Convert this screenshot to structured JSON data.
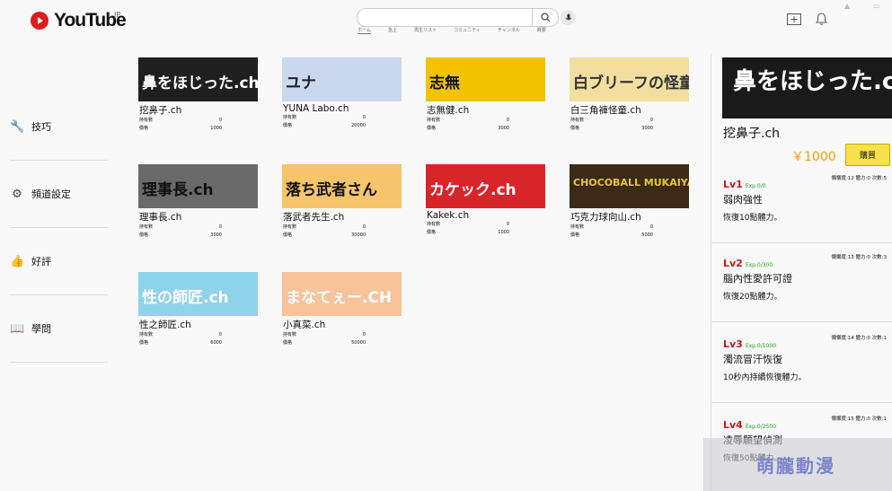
{
  "header": {
    "brand": "YouTube",
    "region": "JP",
    "tabs": [
      "ホーム",
      "急上",
      "再生リスト",
      "コミュニティ",
      "チャンネル",
      "概要"
    ]
  },
  "sidebar": {
    "items": [
      {
        "label": "技巧",
        "icon": "wrench-icon"
      },
      {
        "label": "頻道設定",
        "icon": "gear-icon"
      },
      {
        "label": "好評",
        "icon": "thumbs-up-icon"
      },
      {
        "label": "學問",
        "icon": "book-icon"
      }
    ]
  },
  "stat_labels": {
    "owned": "持有數",
    "price": "價格"
  },
  "channels": [
    {
      "name": "挖鼻子.ch",
      "thumb_text": "鼻をほじった.ch",
      "owned": "0",
      "price": "1000",
      "bg": "#1f1f1f",
      "fg": "#ffffff"
    },
    {
      "name": "YUNA Labo.ch",
      "thumb_text": "ユナ",
      "owned": "0",
      "price": "20000",
      "bg": "#c9d8ef",
      "fg": "#222222"
    },
    {
      "name": "志無健.ch",
      "thumb_text": "志無",
      "owned": "0",
      "price": "3000",
      "bg": "#f3c300",
      "fg": "#111111"
    },
    {
      "name": "白三角褲怪童.ch",
      "thumb_text": "白ブリーフの怪童",
      "owned": "0",
      "price": "3000",
      "bg": "#f2dfa0",
      "fg": "#333333"
    },
    {
      "name": "理事長.ch",
      "thumb_text": "理事長.ch",
      "owned": "0",
      "price": "3000",
      "bg": "#6a6a6a",
      "fg": "#111111"
    },
    {
      "name": "落武者先生.ch",
      "thumb_text": "落ち武者さん",
      "owned": "0",
      "price": "30000",
      "bg": "#f5c46b",
      "fg": "#111111"
    },
    {
      "name": "Kakek.ch",
      "thumb_text": "カケック.ch",
      "owned": "0",
      "price": "1000",
      "bg": "#d8252a",
      "fg": "#ffffff"
    },
    {
      "name": "巧克力球向山.ch",
      "thumb_text": "CHOCOBALL MUKAIYAMA",
      "owned": "0",
      "price": "5000",
      "bg": "#3b2b16",
      "fg": "#e8c43a"
    },
    {
      "name": "性之師匠.ch",
      "thumb_text": "性の師匠.ch",
      "owned": "0",
      "price": "6000",
      "bg": "#8fd3ea",
      "fg": "#ffffff"
    },
    {
      "name": "小真菜.ch",
      "thumb_text": "まなてぇー.CH",
      "owned": "0",
      "price": "50000",
      "bg": "#f6c39a",
      "fg": "#ffffff"
    }
  ],
  "detail": {
    "thumb_text": "鼻をほじった.ch",
    "name": "挖鼻子.ch",
    "price": "￥1000",
    "buy_label": "購買",
    "skills": [
      {
        "level": "Lv1",
        "exp": "Exp.0/0",
        "stats": "懶懶度:12 體力:0 次數:5",
        "name": "弱肉強性",
        "desc": "恢復10點體力。"
      },
      {
        "level": "Lv2",
        "exp": "Exp.0/300",
        "stats": "懶懶度:13 體力:0 次數:3",
        "name": "腦內性愛許可證",
        "desc": "恢復20點體力。"
      },
      {
        "level": "Lv3",
        "exp": "Exp.0/1000",
        "stats": "懶懶度:14 體力:0 次數:1",
        "name": "濁流冒汗恢復",
        "desc": "10秒內持續恢復體力。"
      },
      {
        "level": "Lv4",
        "exp": "Exp.0/2500",
        "stats": "懶懶度:15 體力:0 次數:1",
        "name": "凌辱願望偵測",
        "desc": "恢復50點體力。"
      }
    ]
  },
  "watermark": "萌朧動漫"
}
